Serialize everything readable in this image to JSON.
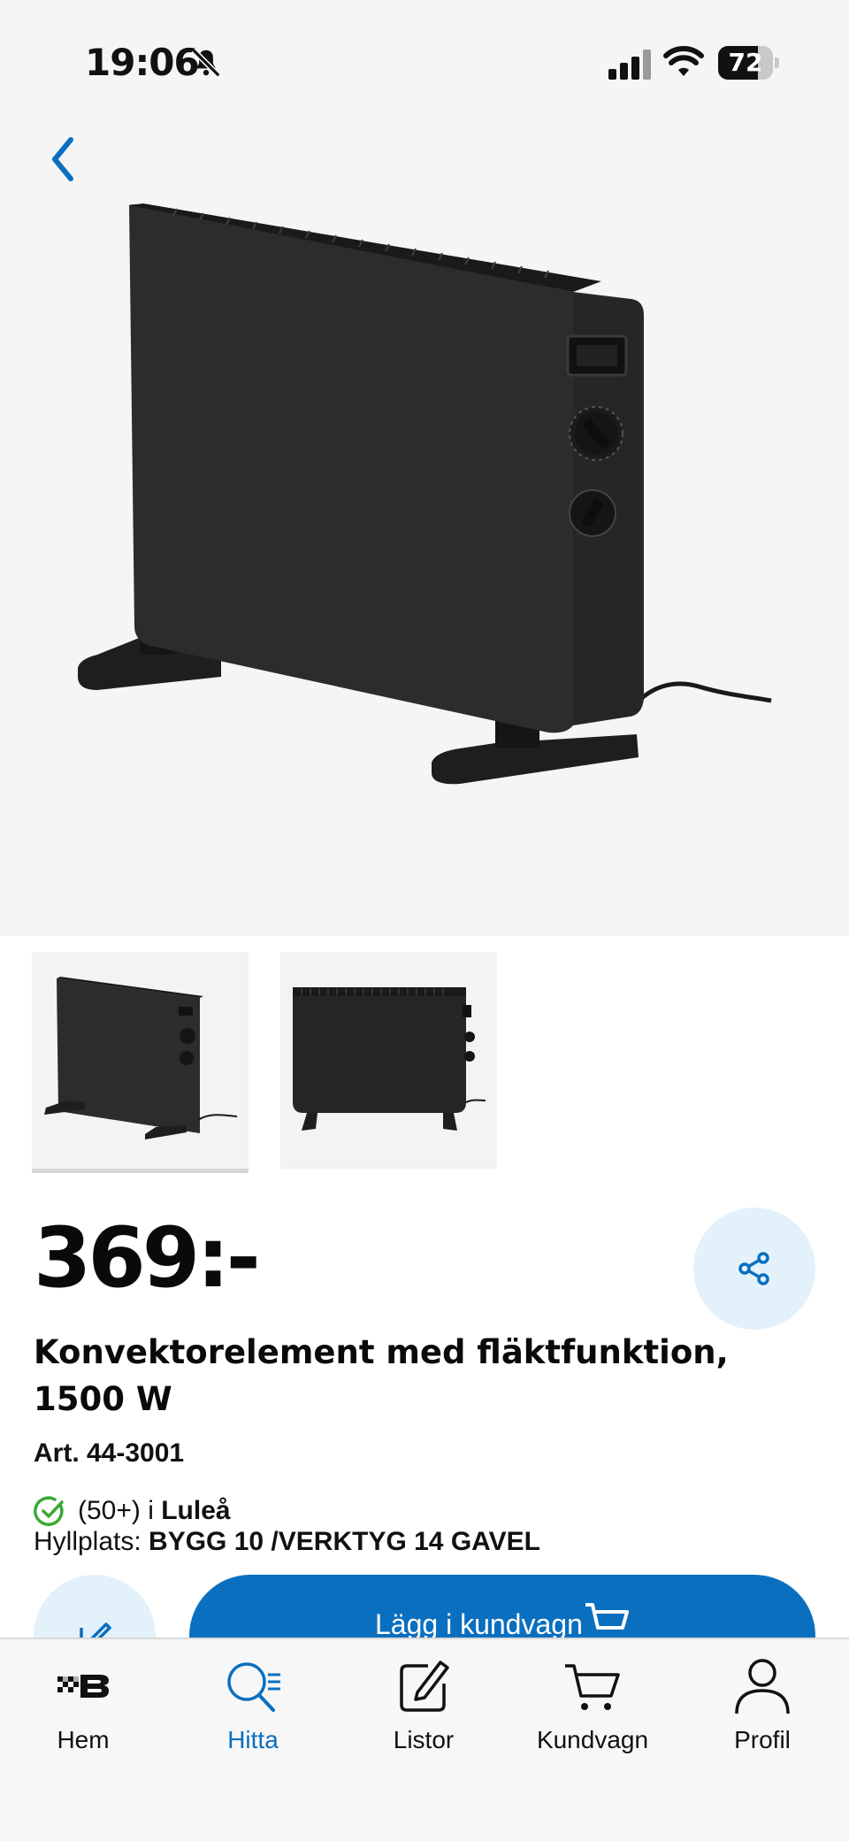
{
  "status_bar": {
    "time": "19:06",
    "battery_percent": "72",
    "battery_level": 0.72
  },
  "product": {
    "price": "369:-",
    "title": "Konvektorelement med fläktfunktion,  1500 W",
    "article": "Art. 44-3001",
    "stock_count": "(50+) i ",
    "stock_store": "Luleå",
    "shelf_label": "Hyllplats: ",
    "shelf_value": "BYGG 10 /VERKTYG 14 GAVEL",
    "thumbnail_count": 2,
    "active_thumbnail": 1
  },
  "actions": {
    "add_to_cart": "Lägg i kundvagn"
  },
  "tabs": [
    {
      "label": "Hem",
      "icon": "bauhaus-logo-icon",
      "active": false
    },
    {
      "label": "Hitta",
      "icon": "search-list-icon",
      "active": true
    },
    {
      "label": "Listor",
      "icon": "edit-list-icon",
      "active": false
    },
    {
      "label": "Kundvagn",
      "icon": "cart-icon",
      "active": false
    },
    {
      "label": "Profil",
      "icon": "person-icon",
      "active": false
    }
  ],
  "colors": {
    "accent": "#0b6fbf",
    "accent_light": "#e3f1fb",
    "stock_green": "#3aaa35",
    "background": "#f5f5f5"
  }
}
